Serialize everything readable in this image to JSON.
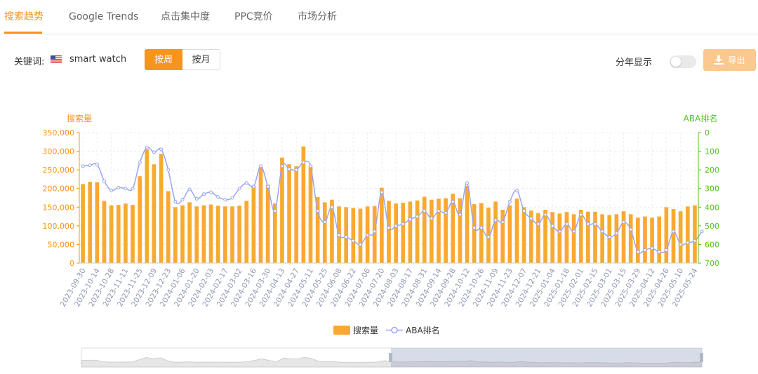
{
  "tabs": [
    {
      "label": "搜索趋势",
      "active": true
    },
    {
      "label": "Google Trends",
      "active": false
    },
    {
      "label": "点击集中度",
      "active": false
    },
    {
      "label": "PPC竞价",
      "active": false
    },
    {
      "label": "市场分析",
      "active": false
    }
  ],
  "toolbar": {
    "keyword_label": "关键词:",
    "flag_icon": "us-flag-icon",
    "keyword_value": "smart watch",
    "period_options": [
      {
        "label": "按周",
        "selected": true
      },
      {
        "label": "按月",
        "selected": false
      }
    ],
    "yearly_label": "分年显示",
    "yearly_on": false,
    "export_icon": "download-icon",
    "export_label": "导出"
  },
  "colors": {
    "accent": "#f7941e",
    "bar": "#f9a932",
    "rank_line": "#9aa5f2",
    "left_axis": "#f7941e",
    "right_axis": "#52c41a",
    "tick_text": "#8e97b0"
  },
  "chart_data": {
    "type": "bar",
    "title": "",
    "y_left_label": "搜索量",
    "y_right_label": "ABA排名",
    "y_left_range": [
      0,
      350000
    ],
    "y_left_ticks": [
      "350,000",
      "300,000",
      "250,000",
      "200,000",
      "150,000",
      "100,000",
      "50,000",
      "0"
    ],
    "y_right_range": [
      0,
      700
    ],
    "y_right_inverted": true,
    "y_right_ticks": [
      "0",
      "100",
      "200",
      "300",
      "400",
      "500",
      "600",
      "700"
    ],
    "x_tick_labels": [
      "2023-09-30",
      "2023-10-14",
      "2023-10-28",
      "2023-11-11",
      "2023-11-25",
      "2023-12-09",
      "2023-12-23",
      "2024-01-06",
      "2024-01-20",
      "2024-02-03",
      "2024-02-17",
      "2024-03-02",
      "2024-03-16",
      "2024-03-30",
      "2024-04-13",
      "2024-04-27",
      "2024-05-11",
      "2024-05-25",
      "2024-06-08",
      "2024-06-22",
      "2024-07-06",
      "2024-07-20",
      "2024-08-03",
      "2024-08-17",
      "2024-08-31",
      "2024-09-14",
      "2024-09-28",
      "2024-10-12",
      "2024-10-26",
      "2024-11-09",
      "2024-11-23",
      "2024-12-07",
      "2024-12-21",
      "2025-01-04",
      "2025-01-18",
      "2025-02-01",
      "2025-02-15",
      "2025-03-01",
      "2025-03-15",
      "2025-03-29",
      "2025-04-12",
      "2025-04-26",
      "2025-05-10",
      "2025-05-24"
    ],
    "grid": true,
    "legend_position": "bottom",
    "series": [
      {
        "name": "搜索量",
        "kind": "bar",
        "axis": "left",
        "values": [
          212000,
          218000,
          217000,
          167000,
          155000,
          156000,
          160000,
          156000,
          233000,
          305000,
          265000,
          293000,
          193000,
          150000,
          155000,
          163000,
          152000,
          155000,
          157000,
          154000,
          152000,
          152000,
          154000,
          167000,
          208000,
          258000,
          210000,
          160000,
          283000,
          265000,
          260000,
          313000,
          260000,
          177000,
          163000,
          170000,
          152000,
          150000,
          148000,
          146000,
          152000,
          153000,
          202000,
          167000,
          160000,
          162000,
          165000,
          168000,
          178000,
          170000,
          173000,
          174000,
          186000,
          174000,
          207000,
          158000,
          161000,
          149000,
          165000,
          143000,
          155000,
          173000,
          150000,
          141000,
          134000,
          143000,
          137000,
          133000,
          137000,
          131000,
          143000,
          138000,
          138000,
          131000,
          129000,
          131000,
          139000,
          131000,
          122000,
          125000,
          122000,
          125000,
          150000,
          145000,
          139000,
          152000,
          155000
        ]
      },
      {
        "name": "ABA排名",
        "kind": "line",
        "axis": "right",
        "values": [
          180,
          175,
          170,
          260,
          310,
          295,
          300,
          300,
          160,
          80,
          105,
          90,
          200,
          370,
          360,
          305,
          355,
          330,
          320,
          345,
          360,
          350,
          300,
          270,
          290,
          180,
          290,
          420,
          180,
          195,
          200,
          160,
          180,
          420,
          480,
          400,
          550,
          560,
          580,
          600,
          550,
          530,
          320,
          510,
          500,
          490,
          465,
          450,
          420,
          460,
          420,
          430,
          370,
          440,
          270,
          510,
          510,
          560,
          470,
          480,
          370,
          310,
          420,
          460,
          490,
          440,
          500,
          530,
          490,
          530,
          440,
          490,
          490,
          530,
          560,
          540,
          480,
          520,
          640,
          630,
          620,
          640,
          630,
          530,
          600,
          590,
          580,
          530
        ]
      }
    ]
  },
  "legend": {
    "bar_label": "搜索量",
    "line_label": "ABA排名"
  }
}
